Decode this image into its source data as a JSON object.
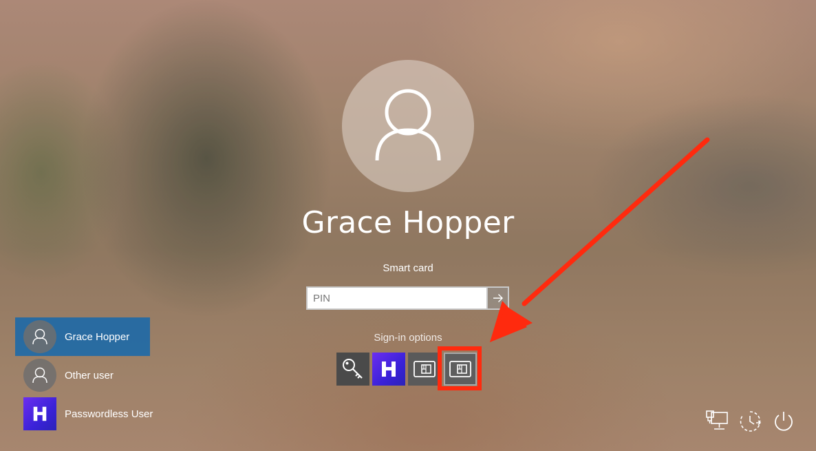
{
  "user": {
    "name": "Grace Hopper"
  },
  "auth": {
    "method_label": "Smart card",
    "pin_placeholder": "PIN",
    "pin_value": ""
  },
  "signin_options": {
    "label": "Sign-in options",
    "items": [
      {
        "icon": "key-icon",
        "label": ""
      },
      {
        "icon": "hypr-logo-icon",
        "label": "H"
      },
      {
        "icon": "smart-card-icon",
        "label": ""
      },
      {
        "icon": "smart-card-icon",
        "label": "",
        "selected": true
      }
    ]
  },
  "users": [
    {
      "name": "Grace Hopper",
      "icon": "person-icon",
      "selected": true
    },
    {
      "name": "Other user",
      "icon": "person-icon"
    },
    {
      "name": "Passwordless User",
      "icon": "hypr-logo-icon",
      "logo_text": "H"
    }
  ],
  "system_icons": [
    "network-icon",
    "ease-of-access-icon",
    "power-icon"
  ],
  "colors": {
    "selected_user": "#1969AA",
    "annotation": "#FF2A0E",
    "hypr_brand": "#4B28E0"
  }
}
